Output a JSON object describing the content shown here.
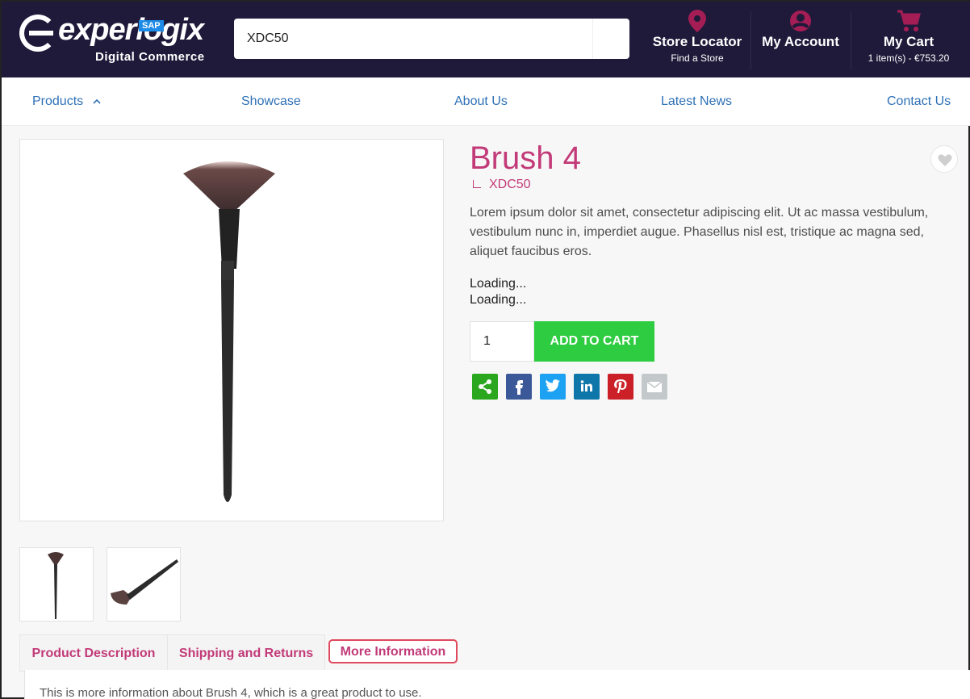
{
  "header": {
    "logo_brand": "experlogix",
    "logo_badge": "SAP",
    "logo_sub": "Digital Commerce",
    "search_value": "XDC50",
    "store_locator": {
      "title": "Store Locator",
      "sub": "Find a Store",
      "icon": "map-pin-icon"
    },
    "account": {
      "title": "My Account",
      "icon": "user-circle-icon"
    },
    "cart": {
      "title": "My Cart",
      "sub": "1 item(s) - €753.20",
      "icon": "cart-icon"
    }
  },
  "nav": {
    "items": [
      "Products",
      "Showcase",
      "About Us",
      "Latest News",
      "Contact Us"
    ]
  },
  "product": {
    "name": "Brush 4",
    "sku": "XDC50",
    "description": "Lorem ipsum dolor sit amet, consectetur adipiscing elit. Ut ac massa vestibulum, vestibulum nunc in, imperdiet augue. Phasellus nisl est, tristique ac magna sed, aliquet faucibus eros.",
    "loading1": "Loading...",
    "loading2": "Loading...",
    "quantity": "1",
    "add_to_cart": "ADD TO CART"
  },
  "share": [
    {
      "name": "share",
      "color": "#2aa61f"
    },
    {
      "name": "facebook",
      "color": "#3b5998"
    },
    {
      "name": "twitter",
      "color": "#1da1f2"
    },
    {
      "name": "linkedin",
      "color": "#0e76a8"
    },
    {
      "name": "pinterest",
      "color": "#cb2027"
    },
    {
      "name": "email",
      "color": "#c3c8cb"
    }
  ],
  "tabs": {
    "items": [
      "Product Description",
      "Shipping and Returns",
      "More Information"
    ],
    "active": 2,
    "panel_text": "This is more information about Brush 4, which is a great product to use."
  },
  "colors": {
    "header_bg": "#1f1a3a",
    "accent": "#c23a78",
    "icon_accent": "#a51d55",
    "cart_green": "#2ecc40",
    "nav_link": "#2f71b6"
  }
}
